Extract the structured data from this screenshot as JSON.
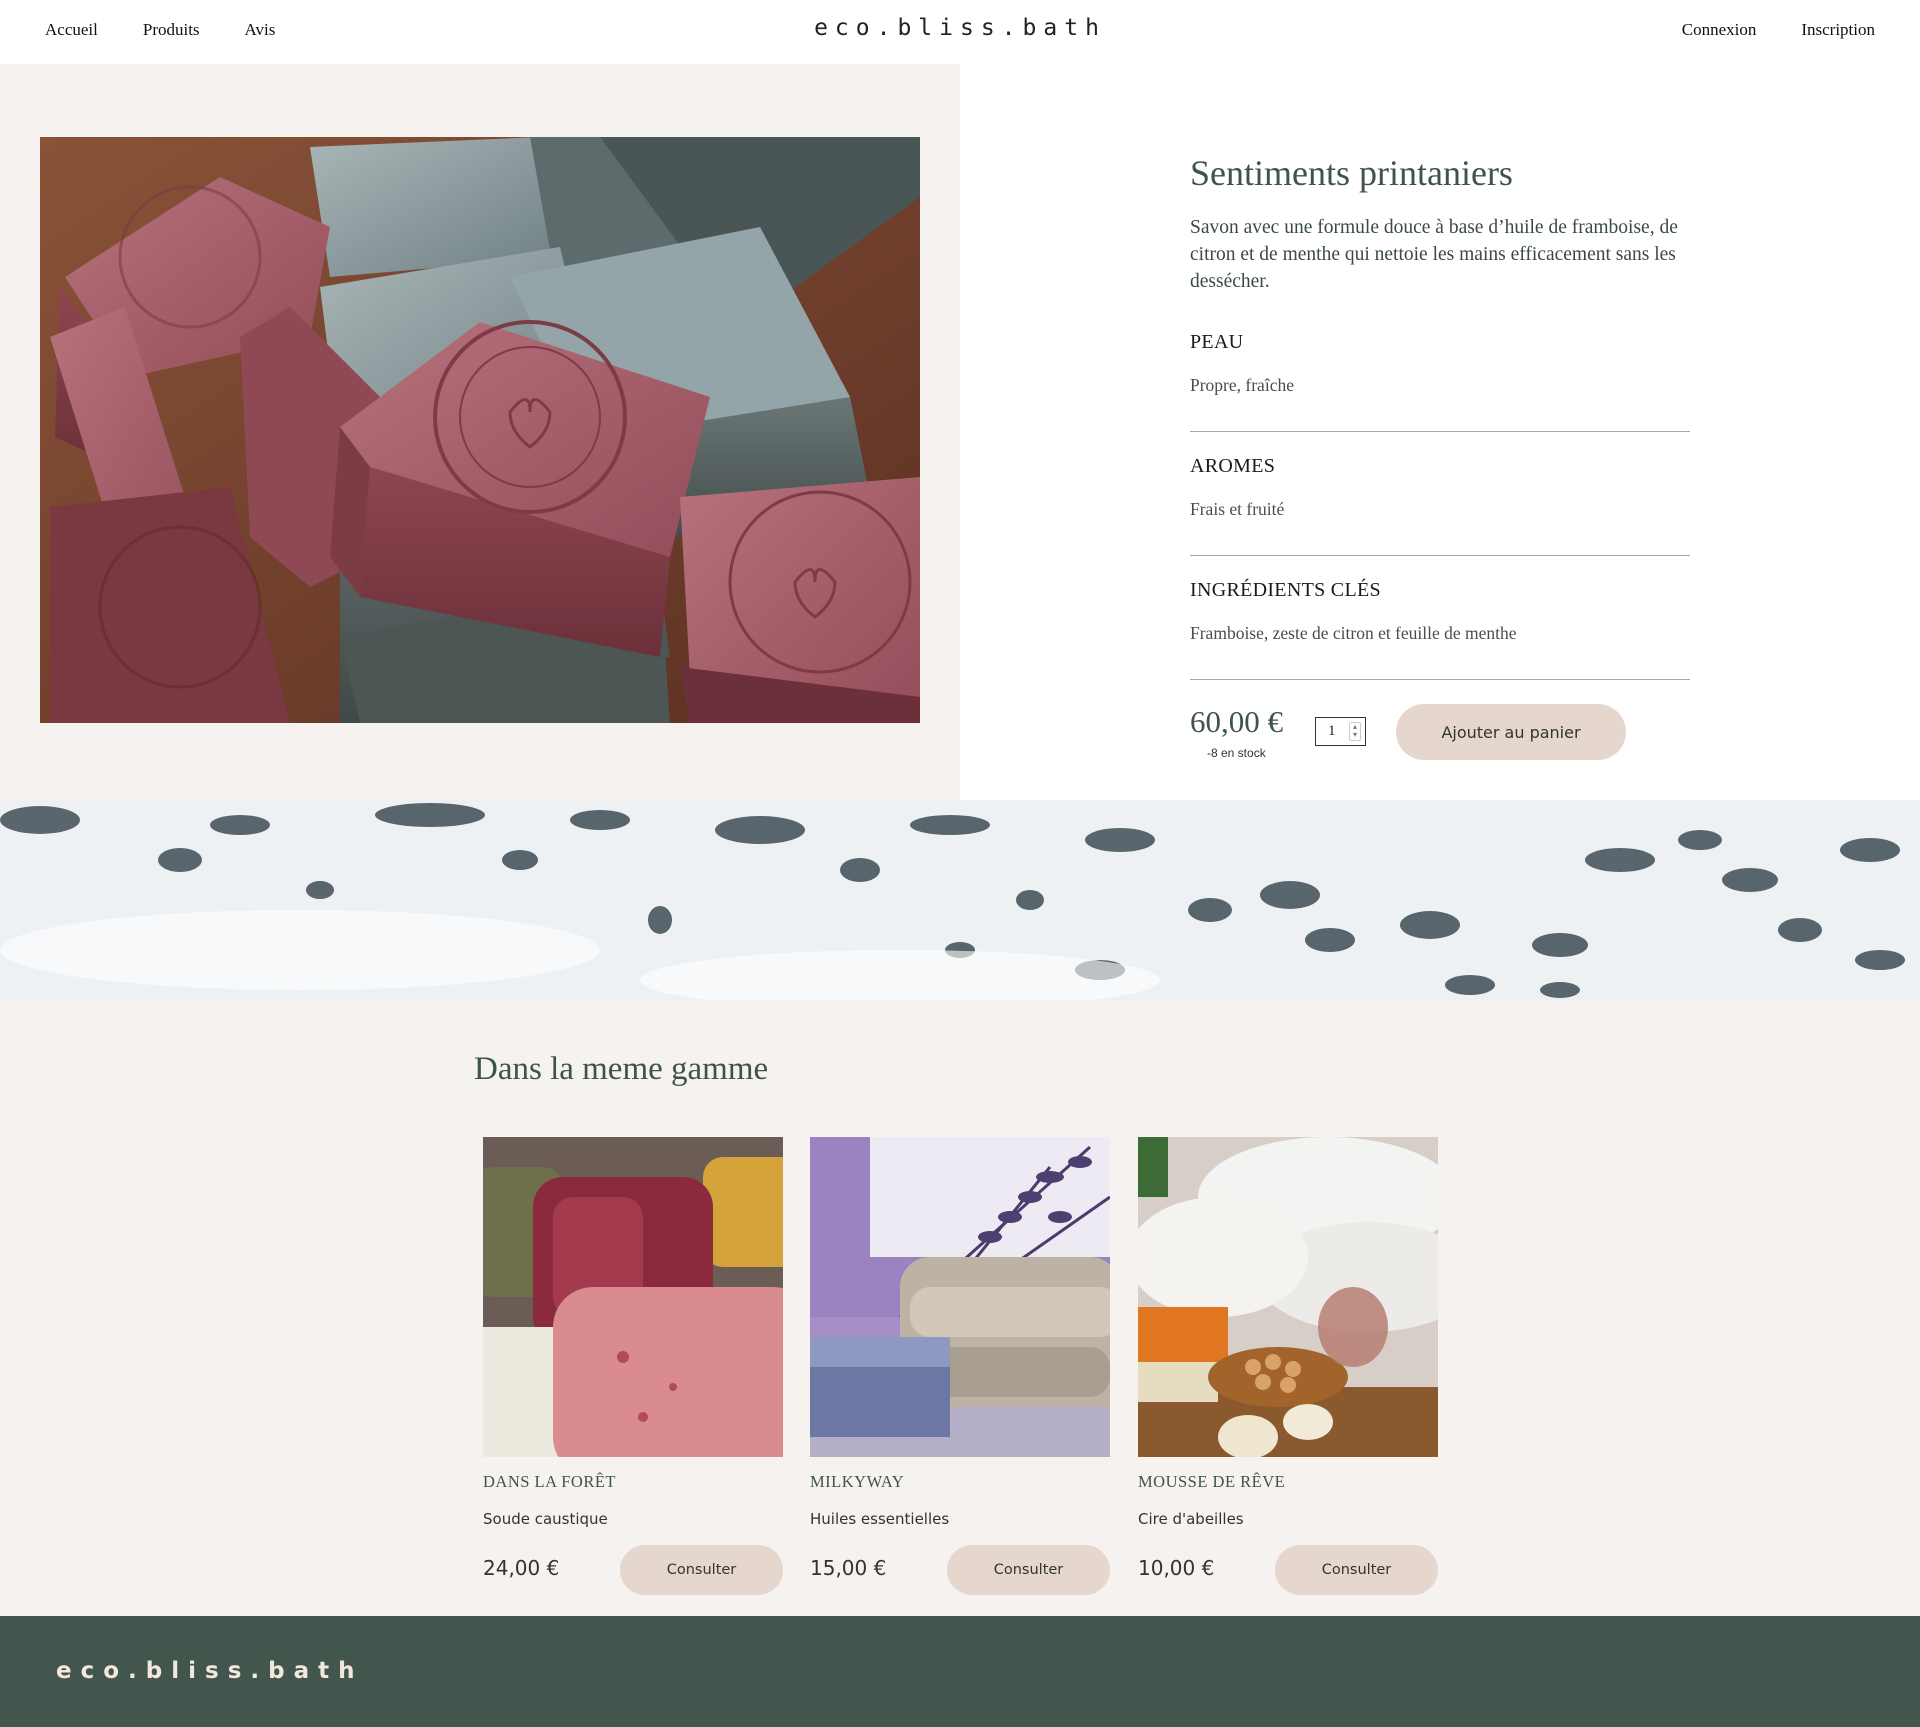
{
  "header": {
    "nav_left": [
      "Accueil",
      "Produits",
      "Avis"
    ],
    "brand": "eco.bliss.bath",
    "nav_right": [
      "Connexion",
      "Inscription"
    ]
  },
  "product": {
    "image_icon": "soap-bars-photo",
    "title": "Sentiments printaniers",
    "description": "Savon avec une formule douce à base d’huile de framboise, de citron et de menthe qui nettoie les mains efficacement sans les dessécher.",
    "specs": [
      {
        "label": "PEAU",
        "value": "Propre, fraîche"
      },
      {
        "label": "AROMES",
        "value": "Frais et fruité"
      },
      {
        "label": "INGRÉDIENTS CLÉS",
        "value": "Framboise, zeste de citron et feuille de menthe"
      }
    ],
    "price": "60,00 €",
    "stock": "-8 en stock",
    "quantity": "1",
    "add_to_cart": "Ajouter au panier"
  },
  "related": {
    "title": "Dans la meme gamme",
    "items": [
      {
        "name": "DANS LA FORÊT",
        "ingredient": "Soude caustique",
        "price": "24,00 €",
        "button": "Consulter"
      },
      {
        "name": "MILKYWAY",
        "ingredient": "Huiles essentielles",
        "price": "15,00 €",
        "button": "Consulter"
      },
      {
        "name": "MOUSSE DE RÊVE",
        "ingredient": "Cire d'abeilles",
        "price": "10,00 €",
        "button": "Consulter"
      }
    ]
  },
  "footer": {
    "brand": "eco.bliss.bath"
  },
  "colors": {
    "accent_green": "#3f5448",
    "button_beige": "#e6d7ce",
    "footer_green": "#43564d",
    "section_bg": "#f6f2ef"
  }
}
